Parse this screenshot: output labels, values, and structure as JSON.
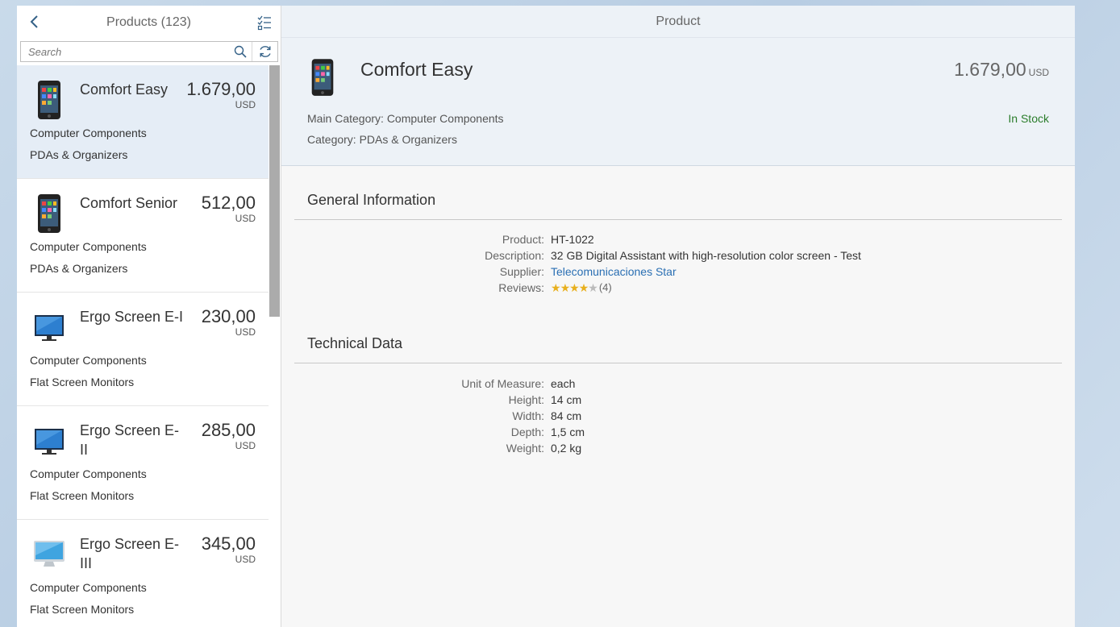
{
  "master": {
    "title": "Products (123)",
    "search_placeholder": "Search",
    "items": [
      {
        "name": "Comfort Easy",
        "price": "1.679,00",
        "currency": "USD",
        "category": "Computer Components",
        "subcategory": "PDAs & Organizers",
        "icon": "smartphone-icon"
      },
      {
        "name": "Comfort Senior",
        "price": "512,00",
        "currency": "USD",
        "category": "Computer Components",
        "subcategory": "PDAs & Organizers",
        "icon": "smartphone-icon"
      },
      {
        "name": "Ergo Screen E-I",
        "price": "230,00",
        "currency": "USD",
        "category": "Computer Components",
        "subcategory": "Flat Screen Monitors",
        "icon": "monitor-icon"
      },
      {
        "name": "Ergo Screen E-II",
        "price": "285,00",
        "currency": "USD",
        "category": "Computer Components",
        "subcategory": "Flat Screen Monitors",
        "icon": "monitor-icon"
      },
      {
        "name": "Ergo Screen E-III",
        "price": "345,00",
        "currency": "USD",
        "category": "Computer Components",
        "subcategory": "Flat Screen Monitors",
        "icon": "monitor-icon"
      }
    ]
  },
  "detail": {
    "title": "Product",
    "product_name": "Comfort Easy",
    "price": "1.679,00",
    "currency": "USD",
    "main_category": "Main Category: Computer Components",
    "category": "Category: PDAs & Organizers",
    "status": "In Stock",
    "general": {
      "title": "General Information",
      "product_label": "Product:",
      "product_value": "HT-1022",
      "description_label": "Description:",
      "description_value": "32 GB Digital Assistant with high-resolution color screen - Test",
      "supplier_label": "Supplier:",
      "supplier_value": "Telecomunicaciones Star",
      "reviews_label": "Reviews:",
      "reviews_count": "(4)",
      "rating": 4,
      "rating_max": 5
    },
    "technical": {
      "title": "Technical Data",
      "uom_label": "Unit of Measure:",
      "uom_value": "each",
      "height_label": "Height:",
      "height_value": "14 cm",
      "width_label": "Width:",
      "width_value": "84 cm",
      "depth_label": "Depth:",
      "depth_value": "1,5 cm",
      "weight_label": "Weight:",
      "weight_value": "0,2 kg"
    }
  },
  "colors": {
    "accent": "#346187",
    "link": "#2a6fb3",
    "in_stock": "#2b7d2b",
    "selected_row": "#e5edf6"
  }
}
